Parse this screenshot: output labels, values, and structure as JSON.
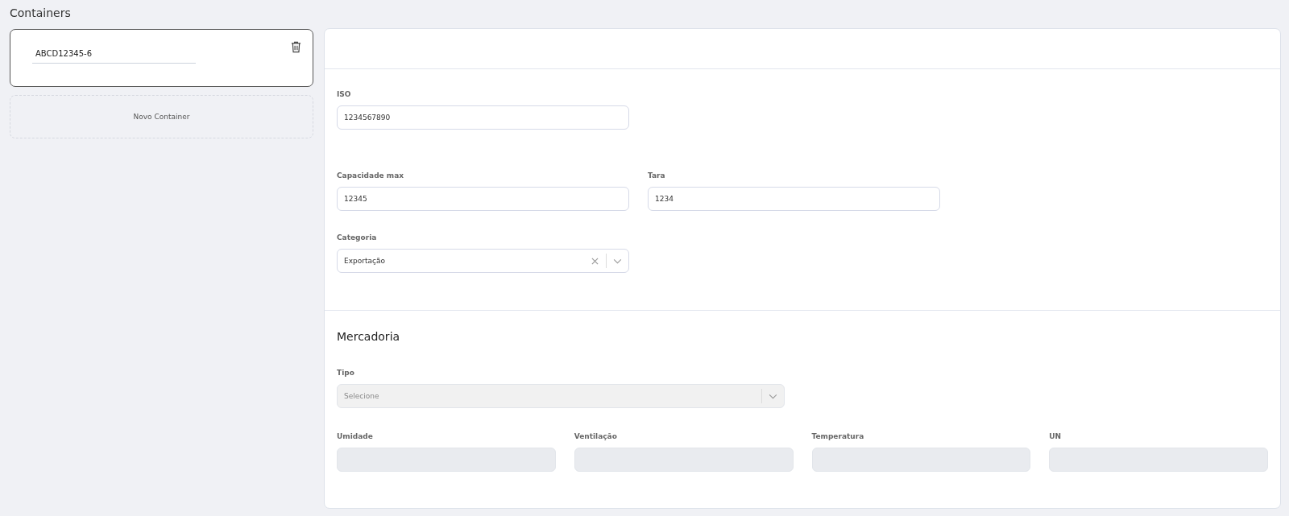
{
  "heading": "Containers",
  "containers": [
    {
      "value": "ABCD12345-6",
      "selected": true
    }
  ],
  "new_container": "Novo Container",
  "main": {
    "rows": [
      [
        {
          "kind": "text",
          "label": "ISO",
          "value": "1234567890",
          "disabled": false
        }
      ],
      [
        {
          "kind": "text",
          "label": "Capacidade max",
          "value": "12345",
          "disabled": false
        },
        {
          "kind": "text",
          "label": "Tara",
          "value": "1234",
          "disabled": false
        }
      ],
      [
        {
          "kind": "select",
          "label": "Categoria",
          "value": "Exportação",
          "clearable": true,
          "disabled": false
        }
      ]
    ]
  },
  "mercadoria": {
    "title": "Mercadoria",
    "tipo": {
      "kind": "select",
      "label": "Tipo",
      "placeholder": "Selecione",
      "clearable": false,
      "disabled": true
    },
    "fields": [
      {
        "kind": "text",
        "label": "Umidade",
        "disabled": true
      },
      {
        "kind": "text",
        "label": "Ventilação",
        "disabled": true
      },
      {
        "kind": "text",
        "label": "Temperatura",
        "disabled": true
      },
      {
        "kind": "text",
        "label": "UN",
        "disabled": true
      }
    ]
  }
}
